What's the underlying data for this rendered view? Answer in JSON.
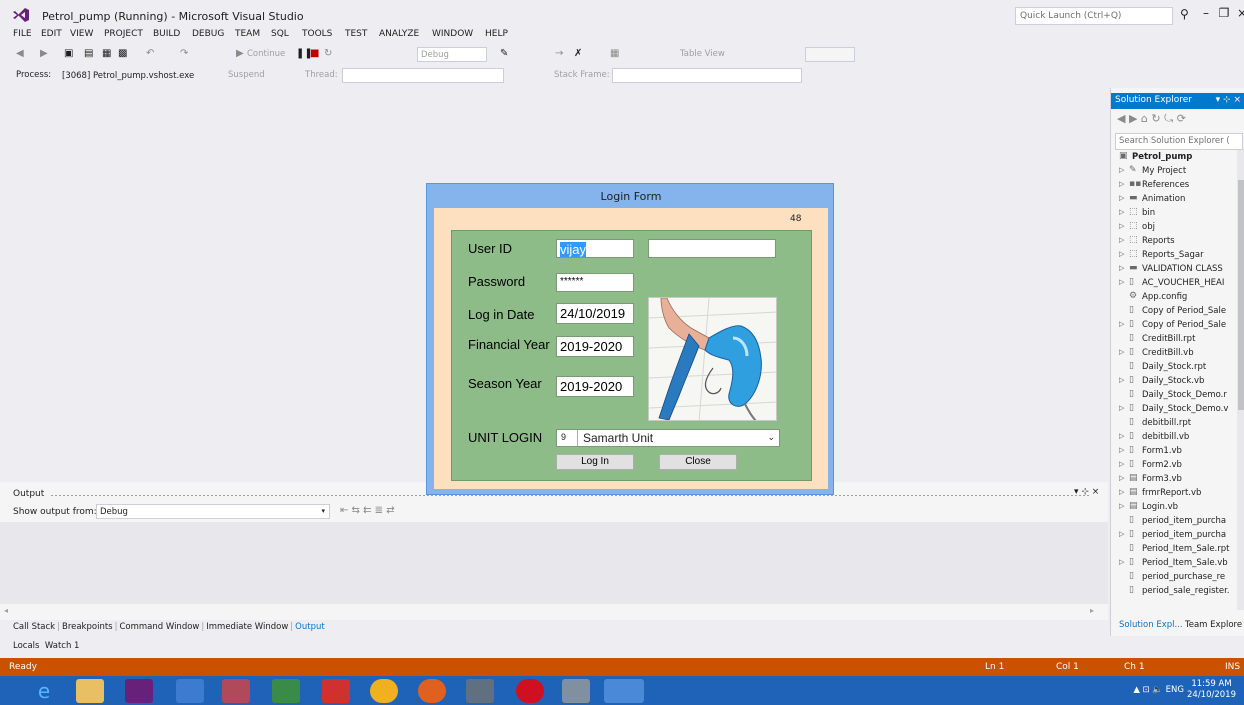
{
  "window": {
    "title": "Petrol_pump (Running) - Microsoft Visual Studio",
    "quick_launch_placeholder": "Quick Launch (Ctrl+Q)"
  },
  "menu": [
    "FILE",
    "EDIT",
    "VIEW",
    "PROJECT",
    "BUILD",
    "DEBUG",
    "TEAM",
    "SQL",
    "TOOLS",
    "TEST",
    "ANALYZE",
    "WINDOW",
    "HELP"
  ],
  "toolbar": {
    "continue_label": "Continue",
    "config_value": "Debug",
    "table_view_label": "Table View"
  },
  "debugbar": {
    "process_label": "Process:",
    "process_value": "[3068] Petrol_pump.vshost.exe",
    "suspend_label": "Suspend",
    "thread_label": "Thread:",
    "stack_frame_label": "Stack Frame:"
  },
  "solution_explorer": {
    "title": "Solution Explorer",
    "search_placeholder": "Search Solution Explorer (",
    "items": [
      {
        "label": "Petrol_pump",
        "icon": "vb-project-icon",
        "expand": false,
        "bold": true
      },
      {
        "label": "My Project",
        "icon": "wrench-icon",
        "expand": true
      },
      {
        "label": "References",
        "icon": "references-icon",
        "expand": true
      },
      {
        "label": "Animation",
        "icon": "folder-icon",
        "expand": true
      },
      {
        "label": "bin",
        "icon": "folder-dashed-icon",
        "expand": true
      },
      {
        "label": "obj",
        "icon": "folder-dashed-icon",
        "expand": true
      },
      {
        "label": "Reports",
        "icon": "folder-dashed-icon",
        "expand": true
      },
      {
        "label": "Reports_Sagar",
        "icon": "folder-dashed-icon",
        "expand": true
      },
      {
        "label": "VALIDATION CLASS",
        "icon": "folder-icon",
        "expand": true
      },
      {
        "label": "AC_VOUCHER_HEAI",
        "icon": "file-icon",
        "expand": true
      },
      {
        "label": "App.config",
        "icon": "config-icon",
        "expand": false
      },
      {
        "label": "Copy of Period_Sale",
        "icon": "file-icon",
        "expand": false
      },
      {
        "label": "Copy of Period_Sale",
        "icon": "file-icon",
        "expand": true
      },
      {
        "label": "CreditBill.rpt",
        "icon": "file-icon",
        "expand": false
      },
      {
        "label": "CreditBill.vb",
        "icon": "file-icon",
        "expand": true
      },
      {
        "label": "Daily_Stock.rpt",
        "icon": "file-icon",
        "expand": false
      },
      {
        "label": "Daily_Stock.vb",
        "icon": "file-icon",
        "expand": true
      },
      {
        "label": "Daily_Stock_Demo.r",
        "icon": "file-icon",
        "expand": false
      },
      {
        "label": "Daily_Stock_Demo.v",
        "icon": "file-icon",
        "expand": true
      },
      {
        "label": "debitbill.rpt",
        "icon": "file-icon",
        "expand": false
      },
      {
        "label": "debitbill.vb",
        "icon": "file-icon",
        "expand": true
      },
      {
        "label": "Form1.vb",
        "icon": "file-icon",
        "expand": true
      },
      {
        "label": "Form2.vb",
        "icon": "file-icon",
        "expand": true
      },
      {
        "label": "Form3.vb",
        "icon": "form-icon",
        "expand": true
      },
      {
        "label": "frmrReport.vb",
        "icon": "form-icon",
        "expand": true
      },
      {
        "label": "Login.vb",
        "icon": "form-icon",
        "expand": true
      },
      {
        "label": "period_item_purcha",
        "icon": "file-icon",
        "expand": false
      },
      {
        "label": "period_item_purcha",
        "icon": "file-icon",
        "expand": true
      },
      {
        "label": "Period_Item_Sale.rpt",
        "icon": "file-icon",
        "expand": false
      },
      {
        "label": "Period_Item_Sale.vb",
        "icon": "file-icon",
        "expand": true
      },
      {
        "label": "period_purchase_re",
        "icon": "file-icon",
        "expand": false
      },
      {
        "label": "period_sale_register.",
        "icon": "file-icon",
        "expand": false
      }
    ],
    "tabs": [
      "Solution Expl...",
      "Team Explore"
    ]
  },
  "output": {
    "title": "Output",
    "show_from_label": "Show output from:",
    "show_from_value": "Debug"
  },
  "bottom_tabs": [
    "Call Stack",
    "Breakpoints",
    "Command Window",
    "Immediate Window",
    "Output"
  ],
  "locals_tabs": [
    "Locals",
    "Watch 1"
  ],
  "status": {
    "ready": "Ready",
    "line": "Ln 1",
    "col": "Col 1",
    "ch": "Ch 1",
    "ins": "INS"
  },
  "taskbar": {
    "icons": [
      "ie-icon",
      "file-explorer-icon",
      "visual-studio-icon",
      "media-icon",
      "database-icon",
      "tool-icon",
      "remote-icon",
      "chrome-icon",
      "firefox-icon",
      "network-icon",
      "opera-icon",
      "app-icon",
      "running-app-icon"
    ],
    "lang": "ENG",
    "time": "11:59 AM",
    "date": "24/10/2019"
  },
  "login": {
    "title": "Login Form",
    "counter": "48",
    "user_id_label": "User ID",
    "user_id_value": "vijay",
    "password_label": "Password",
    "password_value": "******",
    "login_date_label": "Log in Date",
    "login_date_value": "24/10/2019",
    "financial_year_label": "Financial Year",
    "financial_year_value": "2019-2020",
    "season_year_label": "Season Year",
    "season_year_value": "2019-2020",
    "unit_login_label": "UNIT LOGIN",
    "unit_code": "9",
    "unit_name": "Samarth Unit",
    "login_button": "Log In",
    "close_button": "Close"
  },
  "colors": {
    "status_bar": "#ca5100",
    "login_frame": "#85b4ec",
    "login_bg": "#fde0c0",
    "login_panel": "#8ebc89",
    "accent": "#007acc"
  }
}
